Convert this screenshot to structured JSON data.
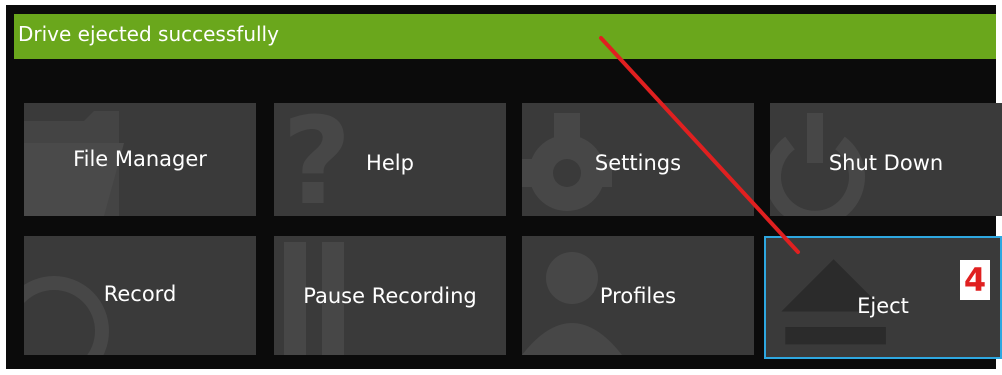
{
  "status": {
    "message": "Drive ejected successfully"
  },
  "menu": {
    "row1": [
      {
        "label": "File Manager",
        "icon": "folder-icon"
      },
      {
        "label": "Help",
        "icon": "question-icon"
      },
      {
        "label": "Settings",
        "icon": "gear-icon"
      },
      {
        "label": "Shut Down",
        "icon": "power-icon"
      }
    ],
    "row2": [
      {
        "label": "Record",
        "icon": "record-icon"
      },
      {
        "label": "Pause Recording",
        "icon": "pause-icon"
      },
      {
        "label": "Profiles",
        "icon": "user-icon"
      },
      {
        "label": "Eject",
        "icon": "eject-icon",
        "selected": true
      }
    ]
  },
  "annotation": {
    "step": "4"
  },
  "colors": {
    "status_bar": "#6aa71c",
    "tile": "#3a3a3a",
    "selection": "#2ea7e0",
    "annotation": "#e02020"
  }
}
